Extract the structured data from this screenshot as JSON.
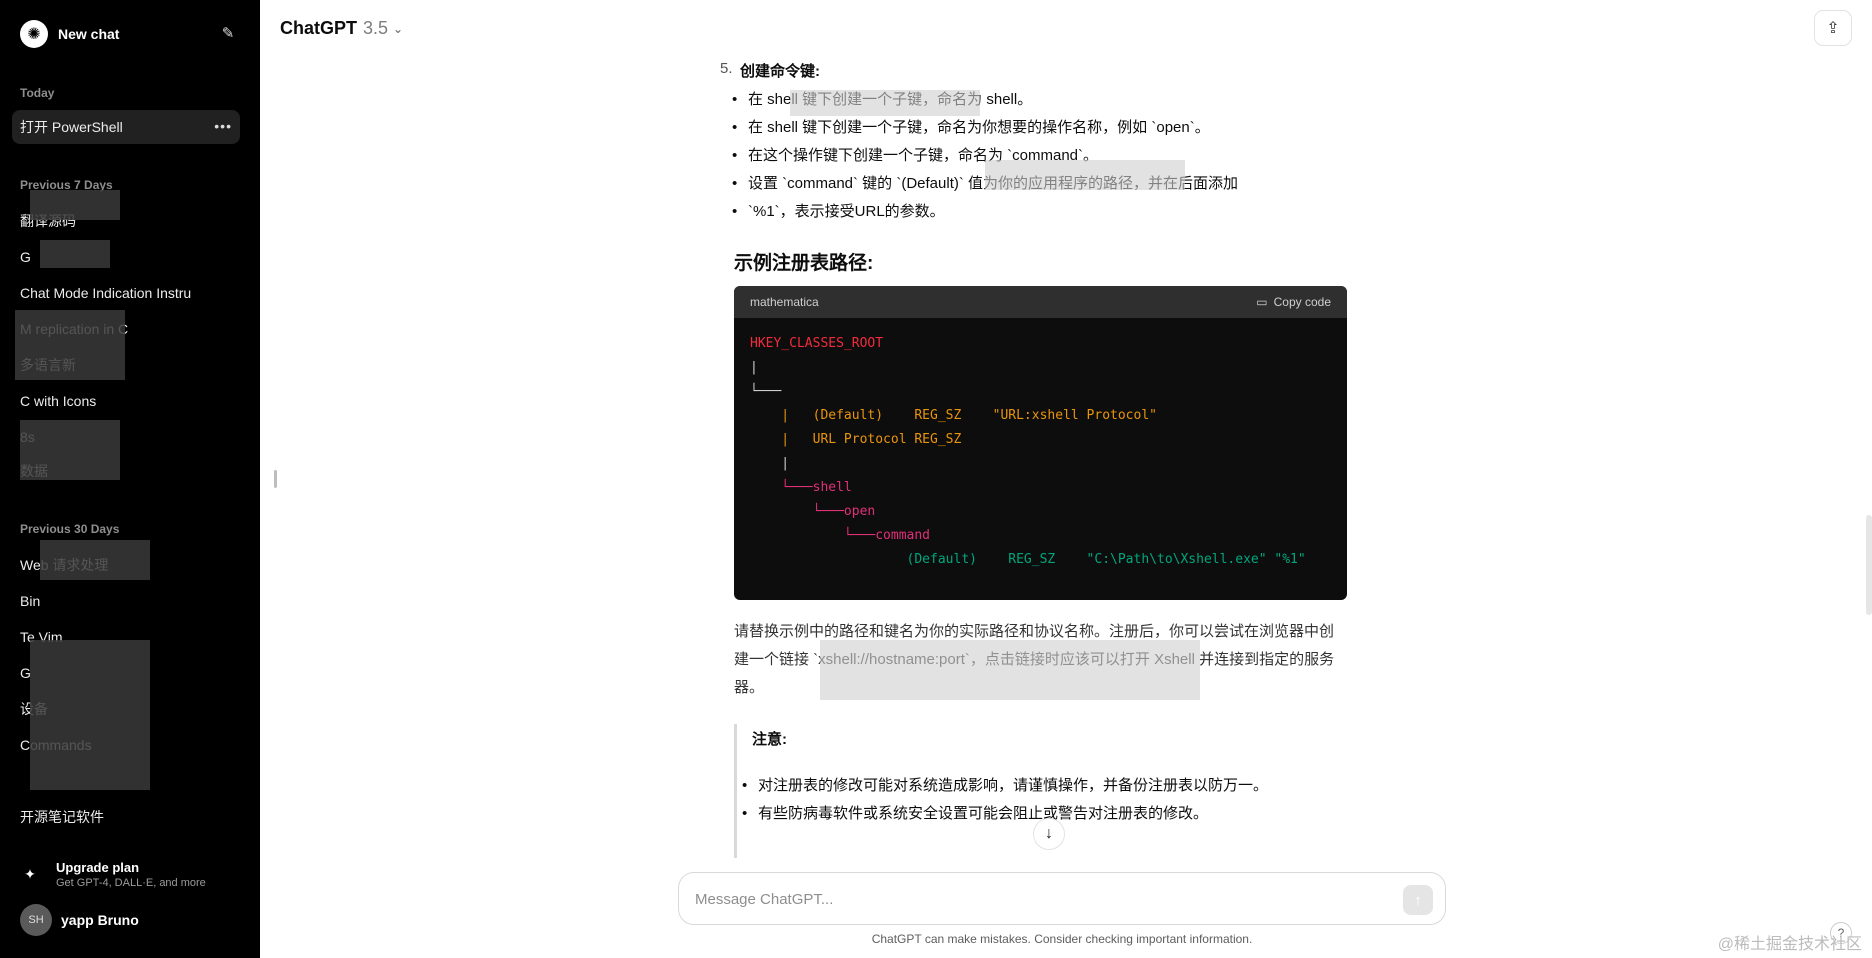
{
  "sidebar": {
    "new_chat": "New chat",
    "sections": {
      "today": "Today",
      "prev7": "Previous 7 Days",
      "prev30": "Previous 30 Days"
    },
    "active_item": "打开 PowerShell",
    "items_prev7": [
      "翻译源码",
      "G",
      "Chat Mode Indication Instru",
      "M replication in C",
      "多语言新",
      "C with Icons",
      "8s",
      "数据"
    ],
    "items_prev30": [
      "Web 请求处理",
      "Bin",
      "Te Vim",
      "G",
      "设备",
      "Commands",
      "",
      "开源笔记软件"
    ],
    "upgrade_title": "Upgrade plan",
    "upgrade_sub": "Get GPT-4, DALL·E, and more",
    "user_initials": "SH",
    "user_name": "yapp Bruno"
  },
  "topbar": {
    "title": "ChatGPT",
    "version": "3.5",
    "share_icon": "share-icon"
  },
  "message": {
    "step_num": "5.",
    "step_title": "创建命令键:",
    "bullets": [
      "在 shell 键下创建一个子键，命名为 shell。",
      "在 shell 键下创建一个子键，命名为你想要的操作名称，例如 `open`。",
      "在这个操作键下创建一个子键，命名为 `command`。",
      "设置 `command` 键的 `(Default)` 值为你的应用程序的路径，并在后面添加",
      "`%1`，表示接受URL的参数。"
    ],
    "heading": "示例注册表路径:",
    "code": {
      "language": "mathematica",
      "copy_label": "Copy code",
      "lines": [
        "HKEY_CLASSES_ROOT",
        "|",
        "└───",
        "    |   (Default)    REG_SZ    \"URL:xshell Protocol\"",
        "    |   URL Protocol REG_SZ",
        "    |",
        "    └───shell",
        "        └───open",
        "            └───command",
        "                    (Default)    REG_SZ    \"C:\\Path\\to\\Xshell.exe\" \"%1\""
      ]
    },
    "paragraph": "请替换示例中的路径和键名为你的实际路径和协议名称。注册后，你可以尝试在浏览器中创建一个链接 `xshell://hostname:port`，点击链接时应该可以打开 Xshell 并连接到指定的服务器。",
    "note_title": "注意:",
    "notes": [
      "对注册表的修改可能对系统造成影响，请谨慎操作，并备份注册表以防万一。",
      "有些防病毒软件或系统安全设置可能会阻止或警告对注册表的修改。"
    ]
  },
  "composer": {
    "placeholder": "Message ChatGPT...",
    "disclaimer": "ChatGPT can make mistakes. Consider checking important information.",
    "help": "?"
  },
  "watermark": "@稀土掘金技术社区"
}
